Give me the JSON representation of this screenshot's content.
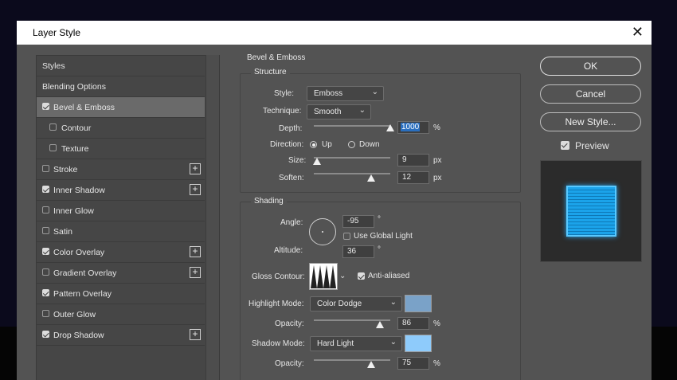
{
  "dialog": {
    "title": "Layer Style"
  },
  "sidebar": {
    "items": [
      {
        "label": "Styles",
        "checkbox": null,
        "plus": false,
        "selected": false,
        "indent": false
      },
      {
        "label": "Blending Options",
        "checkbox": null,
        "plus": false,
        "selected": false,
        "indent": false
      },
      {
        "label": "Bevel & Emboss",
        "checkbox": true,
        "plus": false,
        "selected": true,
        "indent": false
      },
      {
        "label": "Contour",
        "checkbox": false,
        "plus": false,
        "selected": false,
        "indent": true
      },
      {
        "label": "Texture",
        "checkbox": false,
        "plus": false,
        "selected": false,
        "indent": true
      },
      {
        "label": "Stroke",
        "checkbox": false,
        "plus": true,
        "selected": false,
        "indent": false
      },
      {
        "label": "Inner Shadow",
        "checkbox": true,
        "plus": true,
        "selected": false,
        "indent": false
      },
      {
        "label": "Inner Glow",
        "checkbox": false,
        "plus": false,
        "selected": false,
        "indent": false
      },
      {
        "label": "Satin",
        "checkbox": false,
        "plus": false,
        "selected": false,
        "indent": false
      },
      {
        "label": "Color Overlay",
        "checkbox": true,
        "plus": true,
        "selected": false,
        "indent": false
      },
      {
        "label": "Gradient Overlay",
        "checkbox": false,
        "plus": true,
        "selected": false,
        "indent": false
      },
      {
        "label": "Pattern Overlay",
        "checkbox": true,
        "plus": false,
        "selected": false,
        "indent": false
      },
      {
        "label": "Outer Glow",
        "checkbox": false,
        "plus": false,
        "selected": false,
        "indent": false
      },
      {
        "label": "Drop Shadow",
        "checkbox": true,
        "plus": true,
        "selected": false,
        "indent": false
      }
    ]
  },
  "bevel": {
    "section_title": "Bevel & Emboss",
    "structure": {
      "title": "Structure",
      "style_label": "Style:",
      "style_value": "Emboss",
      "technique_label": "Technique:",
      "technique_value": "Smooth",
      "depth_label": "Depth:",
      "depth_value": "1000",
      "depth_unit": "%",
      "depth_level": 1.0,
      "direction_label": "Direction:",
      "direction_up": "Up",
      "direction_down": "Down",
      "direction_selected": "Up",
      "size_label": "Size:",
      "size_value": "9",
      "size_unit": "px",
      "size_level": 0.04,
      "soften_label": "Soften:",
      "soften_value": "12",
      "soften_unit": "px",
      "soften_level": 0.75
    },
    "shading": {
      "title": "Shading",
      "angle_label": "Angle:",
      "angle_value": "-95",
      "angle_unit": "°",
      "global_light_label": "Use Global Light",
      "global_light_checked": false,
      "altitude_label": "Altitude:",
      "altitude_value": "36",
      "altitude_unit": "°",
      "gloss_label": "Gloss Contour:",
      "anti_aliased_label": "Anti-aliased",
      "anti_aliased_checked": true,
      "highlight_label": "Highlight Mode:",
      "highlight_value": "Color Dodge",
      "highlight_color": "#7aa2c8",
      "highlight_opacity_label": "Opacity:",
      "highlight_opacity_value": "86",
      "highlight_opacity_unit": "%",
      "highlight_opacity_level": 0.86,
      "shadow_label": "Shadow Mode:",
      "shadow_value": "Hard Light",
      "shadow_color": "#8ecbfb",
      "shadow_opacity_label": "Opacity:",
      "shadow_opacity_value": "75",
      "shadow_opacity_unit": "%",
      "shadow_opacity_level": 0.75
    }
  },
  "buttons": {
    "ok": "OK",
    "cancel": "Cancel",
    "new_style": "New Style..."
  },
  "preview": {
    "label": "Preview",
    "checked": true
  }
}
